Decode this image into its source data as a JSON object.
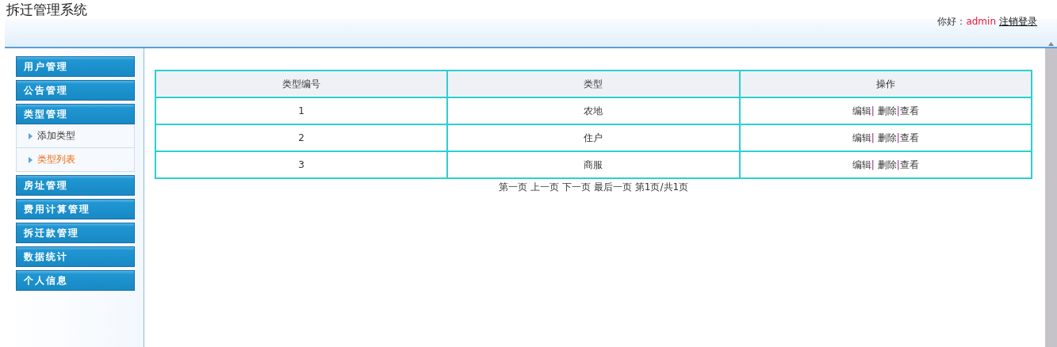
{
  "header": {
    "title": "拆迁管理系统",
    "greeting": "你好：",
    "username": "admin",
    "logout": "注销登录"
  },
  "sidebar": {
    "groups": [
      {
        "label": "用户管理"
      },
      {
        "label": "公告管理"
      },
      {
        "label": "类型管理",
        "children": [
          {
            "label": "添加类型",
            "selected": false
          },
          {
            "label": "类型列表",
            "selected": true
          }
        ]
      },
      {
        "label": "房址管理"
      },
      {
        "label": "费用计算管理"
      },
      {
        "label": "拆迁款管理"
      },
      {
        "label": "数据统计"
      },
      {
        "label": "个人信息"
      }
    ]
  },
  "table": {
    "columns": [
      "类型编号",
      "类型",
      "操作"
    ],
    "rows": [
      {
        "id": "1",
        "type": "农地",
        "actions": [
          {
            "label": "编辑",
            "separator": "|"
          },
          {
            "label": "删除",
            "separator": "|"
          },
          {
            "label": "查看"
          }
        ]
      },
      {
        "id": "2",
        "type": "住户",
        "actions": [
          {
            "label": "编辑",
            "separator": "|"
          },
          {
            "label": "删除",
            "separator": "|"
          },
          {
            "label": "查看"
          }
        ]
      },
      {
        "id": "3",
        "type": "商服",
        "actions": [
          {
            "label": "编辑",
            "separator": "|"
          },
          {
            "label": "删除",
            "separator": "|"
          },
          {
            "label": "查看"
          }
        ]
      }
    ]
  },
  "pagination": {
    "links": [
      "第一页",
      "上一页",
      "下一页",
      "最后一页"
    ],
    "status": "第1页/共1页"
  }
}
